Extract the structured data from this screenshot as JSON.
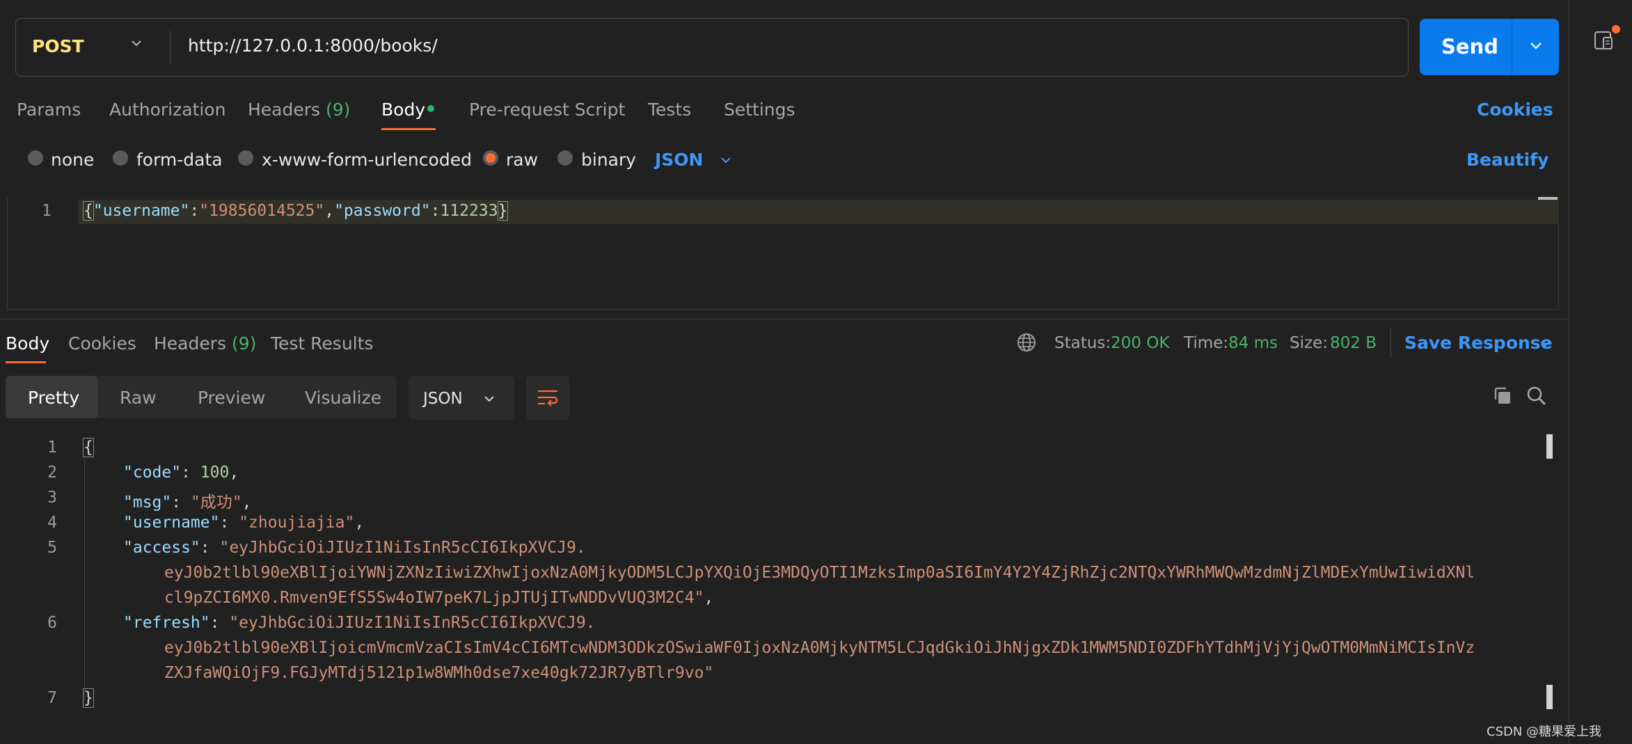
{
  "request": {
    "method": "POST",
    "url": "http://127.0.0.1:8000/books/",
    "send_label": "Send"
  },
  "request_tabs": {
    "params": "Params",
    "authorization": "Authorization",
    "headers": "Headers",
    "headers_count": "(9)",
    "body": "Body",
    "pre_request": "Pre-request Script",
    "tests": "Tests",
    "settings": "Settings",
    "cookies": "Cookies"
  },
  "body_types": {
    "none": "none",
    "form_data": "form-data",
    "urlencoded": "x-www-form-urlencoded",
    "raw": "raw",
    "binary": "binary",
    "selected": "raw",
    "language": "JSON",
    "beautify": "Beautify"
  },
  "request_editor": {
    "line_number": "1",
    "open": "{",
    "key1": "\"username\"",
    "colon": ":",
    "val1": "\"19856014525\"",
    "comma": ",",
    "key2": "\"password\"",
    "val2": "112233",
    "close": "}"
  },
  "response_tabs": {
    "body": "Body",
    "cookies": "Cookies",
    "headers": "Headers",
    "headers_count": "(9)",
    "test_results": "Test Results"
  },
  "response_status": {
    "status_label": "Status:",
    "status_value": "200 OK",
    "time_label": "Time:",
    "time_value": "84 ms",
    "size_label": "Size:",
    "size_value": "802 B",
    "save_response": "Save Response"
  },
  "response_view": {
    "pretty": "Pretty",
    "raw": "Raw",
    "preview": "Preview",
    "visualize": "Visualize",
    "format": "JSON"
  },
  "response_body": {
    "line_numbers": [
      "1",
      "2",
      "3",
      "4",
      "5",
      "6",
      "7"
    ],
    "open": "{",
    "close": "}",
    "code_key": "\"code\"",
    "code_value": "100",
    "msg_key": "\"msg\"",
    "msg_value": "\"成功\"",
    "username_key": "\"username\"",
    "username_value": "\"zhoujiajia\"",
    "access_key": "\"access\"",
    "access_line1": "\"eyJhbGciOiJIUzI1NiIsInR5cCI6IkpXVCJ9.",
    "access_line2": "eyJ0b2tlbl90eXBlIjoiYWNjZXNzIiwiZXhwIjoxNzA0MjkyODM5LCJpYXQiOjE3MDQyOTI1MzksImp0aSI6ImY4Y2Y4ZjRhZjc2NTQxYWRhMWQwMzdmNjZlMDExYmUwIiwidXNl",
    "access_line3": "cl9pZCI6MX0.Rmven9EfS5Sw4oIW7peK7LjpJTUjITwNDDvVUQ3M2C4\"",
    "refresh_key": "\"refresh\"",
    "refresh_line1": "\"eyJhbGciOiJIUzI1NiIsInR5cCI6IkpXVCJ9.",
    "refresh_line2": "eyJ0b2tlbl90eXBlIjoicmVmcmVzaCIsImV4cCI6MTcwNDM3ODkzOSwiaWF0IjoxNzA0MjkyNTM5LCJqdGkiOiJhNjgxZDk1MWM5NDI0ZDFhYTdhMjVjYjQwOTM0MmNiMCIsInVz",
    "refresh_line3": "ZXJfaWQiOjF9.FGJyMTdj5121p1w8WMh0dse7xe40gk72JR7yBTlr9vo\""
  },
  "watermark": "CSDN @糖果爱上我",
  "colors": {
    "accent": "#ff6c37",
    "send": "#097bed",
    "link": "#3e97f5",
    "success": "#49b36b",
    "method": "#ffe47e"
  }
}
